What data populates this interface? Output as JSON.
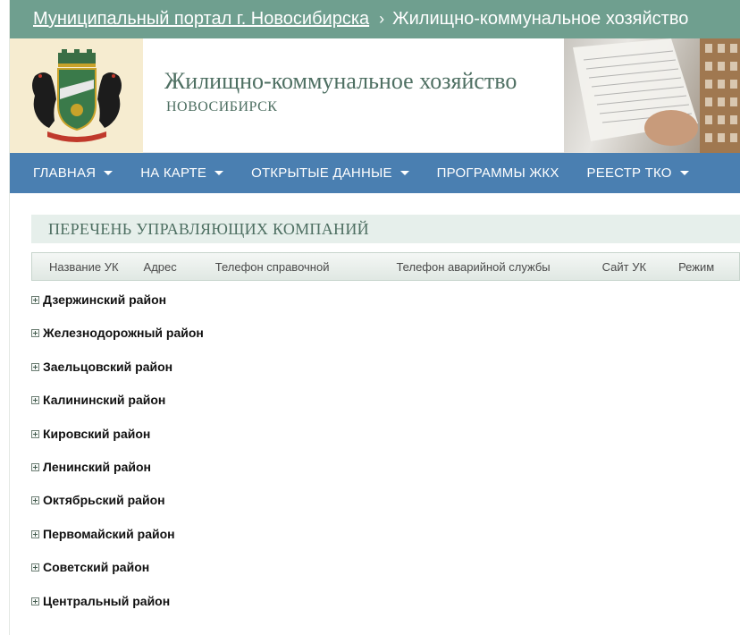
{
  "breadcrumb": {
    "portal_link": "Муниципальный портал г. Новосибирска",
    "separator": "›",
    "current": "Жилищно-коммунальное хозяйство"
  },
  "header": {
    "title": "Жилищно-коммунальное хозяйство",
    "subtitle": "НОВОСИБИРСК",
    "logo_icon": "novosibirsk-coat-of-arms",
    "photo": "utility-bill-photo"
  },
  "nav": {
    "items": [
      {
        "label": "ГЛАВНАЯ",
        "dropdown": true
      },
      {
        "label": "НА КАРТЕ",
        "dropdown": true
      },
      {
        "label": "ОТКРЫТЫЕ ДАННЫЕ",
        "dropdown": true
      },
      {
        "label": "ПРОГРАММЫ ЖКХ",
        "dropdown": false
      },
      {
        "label": "РЕЕСТР ТКО",
        "dropdown": true
      }
    ]
  },
  "list": {
    "title": "ПЕРЕЧЕНЬ УПРАВЛЯЮЩИХ КОМПАНИЙ",
    "columns": [
      "Название УК",
      "Адрес",
      "Телефон справочной",
      "Телефон аварийной службы",
      "Сайт УК",
      "Режим"
    ],
    "districts": [
      "Дзержинский район",
      "Железнодорожный район",
      "Заельцовский район",
      "Калининский район",
      "Кировский район",
      "Ленинский район",
      "Октябрьский район",
      "Первомайский район",
      "Советский район",
      "Центральный район"
    ]
  },
  "colors": {
    "breadcrumb_bg": "#6f9f8f",
    "nav_bg": "#4a7fb1",
    "title_text": "#4e6f62",
    "logo_bg": "#f6ecd0"
  }
}
